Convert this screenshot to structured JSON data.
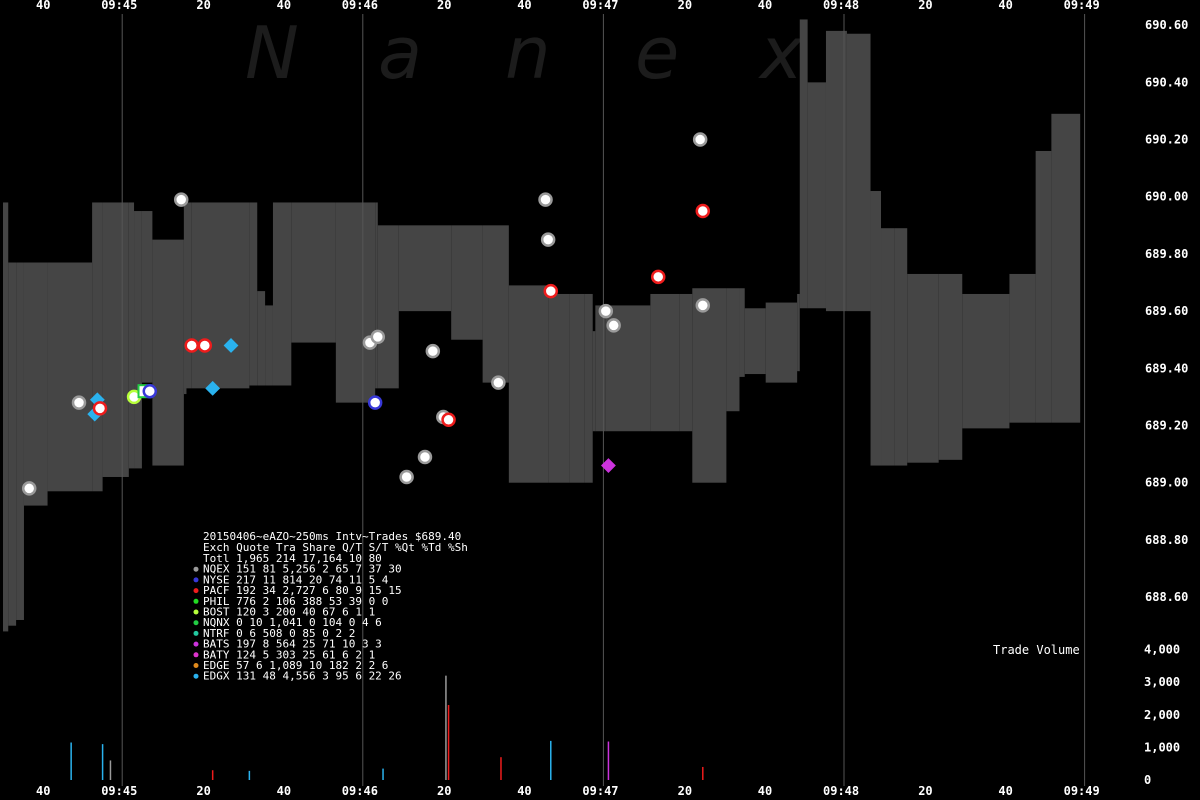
{
  "watermark": [
    "N",
    "a",
    "n",
    "e",
    "x"
  ],
  "chart_data": {
    "type": "scatter",
    "price_axis": {
      "ylim": [
        688.45,
        690.66
      ],
      "ticks": [
        "690.60",
        "690.40",
        "690.20",
        "690.00",
        "689.80",
        "689.60",
        "689.40",
        "689.20",
        "689.00",
        "688.80",
        "688.60"
      ]
    },
    "volume_axis": {
      "ylim": [
        0,
        4600
      ],
      "ticks": [
        "4,000",
        "3,000",
        "2,000",
        "1,000",
        "0"
      ],
      "label": "Trade Volume"
    },
    "time_axis": {
      "tick_labels": [
        "40",
        "09:45",
        "20",
        "40",
        "09:46",
        "20",
        "40",
        "09:47",
        "20",
        "40",
        "09:48",
        "20",
        "40",
        "09:49"
      ],
      "major_label_indices": [
        1,
        4,
        7,
        10,
        13
      ]
    },
    "nbbo_band": [
      [
        0,
        688.48,
        689.98
      ],
      [
        2,
        688.5,
        689.77
      ],
      [
        5,
        688.52,
        689.77
      ],
      [
        8,
        688.92,
        689.77
      ],
      [
        17,
        688.97,
        689.77
      ],
      [
        34,
        688.97,
        689.98
      ],
      [
        38,
        689.02,
        689.98
      ],
      [
        48,
        689.05,
        689.98
      ],
      [
        50,
        689.05,
        689.95
      ],
      [
        53,
        689.35,
        689.95
      ],
      [
        57,
        689.06,
        689.85
      ],
      [
        69,
        689.31,
        689.85
      ],
      [
        70,
        689.31,
        689.98
      ],
      [
        69,
        689.33,
        689.98
      ],
      [
        72,
        689.33,
        689.98
      ],
      [
        94,
        689.34,
        689.98
      ],
      [
        97,
        689.34,
        689.67
      ],
      [
        100,
        689.34,
        689.62
      ],
      [
        103,
        689.34,
        689.98
      ],
      [
        110,
        689.49,
        689.98
      ],
      [
        127,
        689.28,
        689.98
      ],
      [
        142,
        689.33,
        689.98
      ],
      [
        143,
        689.33,
        689.9
      ],
      [
        151,
        689.6,
        689.9
      ],
      [
        153,
        689.6,
        689.9
      ],
      [
        171,
        689.5,
        689.9
      ],
      [
        183,
        689.35,
        689.9
      ],
      [
        193,
        689.0,
        689.69
      ],
      [
        208,
        689.0,
        689.66
      ],
      [
        216,
        689.0,
        689.66
      ],
      [
        222,
        689.0,
        689.66
      ],
      [
        225,
        689.18,
        689.53
      ],
      [
        226,
        689.18,
        689.62
      ],
      [
        230,
        689.18,
        689.62
      ],
      [
        247,
        689.18,
        689.66
      ],
      [
        258,
        689.18,
        689.66
      ],
      [
        263,
        689.0,
        689.68
      ],
      [
        276,
        689.25,
        689.68
      ],
      [
        281,
        689.37,
        689.68
      ],
      [
        283,
        689.38,
        689.61
      ],
      [
        291,
        689.35,
        689.63
      ],
      [
        303,
        689.39,
        689.66
      ],
      [
        304,
        689.61,
        690.62
      ],
      [
        307,
        689.61,
        690.4
      ],
      [
        314,
        689.6,
        690.58
      ],
      [
        322,
        689.6,
        690.57
      ],
      [
        331,
        689.06,
        690.02
      ],
      [
        335,
        689.06,
        689.89
      ],
      [
        340,
        689.06,
        689.89
      ],
      [
        345,
        689.07,
        689.73
      ],
      [
        357,
        689.08,
        689.73
      ],
      [
        366,
        689.19,
        689.66
      ],
      [
        384,
        689.21,
        689.73
      ],
      [
        394,
        689.21,
        690.16
      ],
      [
        400,
        689.21,
        690.29
      ],
      [
        411,
        689.21,
        690.14
      ]
    ],
    "trades": [
      {
        "t": 10,
        "p": 688.98,
        "ex": "NQEX"
      },
      {
        "t": 29,
        "p": 689.28,
        "ex": "NQEX"
      },
      {
        "t": 35,
        "p": 689.24,
        "ex": "EDGX"
      },
      {
        "t": 36,
        "p": 689.29,
        "ex": "EDGX"
      },
      {
        "t": 37,
        "p": 689.26,
        "ex": "PACF"
      },
      {
        "t": 50,
        "p": 689.3,
        "ex": "BOST"
      },
      {
        "t": 54,
        "p": 689.32,
        "ex": "NQNX"
      },
      {
        "t": 56,
        "p": 689.32,
        "ex": "NYSE"
      },
      {
        "t": 68,
        "p": 689.99,
        "ex": "NQEX"
      },
      {
        "t": 72,
        "p": 689.48,
        "ex": "PACF"
      },
      {
        "t": 77,
        "p": 689.48,
        "ex": "PACF"
      },
      {
        "t": 80,
        "p": 689.33,
        "ex": "EDGX"
      },
      {
        "t": 87,
        "p": 689.48,
        "ex": "EDGX"
      },
      {
        "t": 140,
        "p": 689.49,
        "ex": "NQEX"
      },
      {
        "t": 142,
        "p": 689.28,
        "ex": "NYSE"
      },
      {
        "t": 143,
        "p": 689.51,
        "ex": "NQEX"
      },
      {
        "t": 154,
        "p": 689.02,
        "ex": "NQEX"
      },
      {
        "t": 161,
        "p": 689.09,
        "ex": "NQEX"
      },
      {
        "t": 164,
        "p": 689.46,
        "ex": "NQEX"
      },
      {
        "t": 168,
        "p": 689.23,
        "ex": "NQEX"
      },
      {
        "t": 170,
        "p": 689.22,
        "ex": "PACF"
      },
      {
        "t": 189,
        "p": 689.35,
        "ex": "NQEX"
      },
      {
        "t": 207,
        "p": 689.99,
        "ex": "NQEX"
      },
      {
        "t": 208,
        "p": 689.85,
        "ex": "NQEX"
      },
      {
        "t": 209,
        "p": 689.67,
        "ex": "PACF"
      },
      {
        "t": 230,
        "p": 689.6,
        "ex": "NQEX"
      },
      {
        "t": 231,
        "p": 689.06,
        "ex": "BATS"
      },
      {
        "t": 233,
        "p": 689.55,
        "ex": "NQEX"
      },
      {
        "t": 250,
        "p": 689.72,
        "ex": "PACF"
      },
      {
        "t": 266,
        "p": 690.2,
        "ex": "NQEX"
      },
      {
        "t": 267,
        "p": 689.62,
        "ex": "NQEX"
      },
      {
        "t": 267,
        "p": 689.95,
        "ex": "PACF"
      }
    ],
    "volume_bars": [
      {
        "t": 26,
        "v": 1150,
        "ex": "EDGX"
      },
      {
        "t": 38,
        "v": 1100,
        "ex": "EDGX"
      },
      {
        "t": 41,
        "v": 600,
        "ex": "NQEX"
      },
      {
        "t": 80,
        "v": 300,
        "ex": "PACF"
      },
      {
        "t": 94,
        "v": 280,
        "ex": "EDGX"
      },
      {
        "t": 145,
        "v": 350,
        "ex": "EDGX"
      },
      {
        "t": 169,
        "v": 3200,
        "ex": "NQEX"
      },
      {
        "t": 170,
        "v": 2300,
        "ex": "PACF"
      },
      {
        "t": 190,
        "v": 700,
        "ex": "PACF"
      },
      {
        "t": 209,
        "v": 1200,
        "ex": "EDGX"
      },
      {
        "t": 231,
        "v": 1180,
        "ex": "BATS"
      },
      {
        "t": 267,
        "v": 400,
        "ex": "PACF"
      }
    ],
    "exchange_colors": {
      "NQEX": "#9a9a9a",
      "NYSE": "#3838d8",
      "PACF": "#ee1c1c",
      "PHIL": "#22dd22",
      "BOST": "#b7ff3b",
      "NQNX": "#22cc44",
      "NTRF": "#22c9a0",
      "BATS": "#cc33dd",
      "BATY": "#dd33cc",
      "EDGE": "#e08a1c",
      "EDGX": "#2ab2ee"
    }
  },
  "stats": {
    "title": "20150406~eAZO~250ms Intv~Trades $689.40",
    "header": "Exch Quote Tra  Share  Q/T   S/T  %Qt %Td %Sh",
    "rows": [
      {
        "label": "Totl 1,965 214 17,164   10    80",
        "color": ""
      },
      {
        "label": "NQEX   151  81  5,256    2    65   7  37  30",
        "color": "#9a9a9a"
      },
      {
        "label": "NYSE   217  11    814   20    74  11   5   4",
        "color": "#3838d8"
      },
      {
        "label": "PACF   192  34  2,727    6    80   9  15  15",
        "color": "#ee1c1c"
      },
      {
        "label": "PHIL   776   2    106  388    53  39   0   0",
        "color": "#22dd22"
      },
      {
        "label": "BOST   120   3    200   40    67   6   1   1",
        "color": "#b7ff3b"
      },
      {
        "label": "NQNX     0  10  1,041    0   104   0   4   6",
        "color": "#22cc44"
      },
      {
        "label": "NTRF     0   6    508    0    85   0   2   2",
        "color": "#22c9a0"
      },
      {
        "label": "BATS   197   8    564   25    71  10   3   3",
        "color": "#cc33dd"
      },
      {
        "label": "BATY   124   5    303   25    61   6   2   1",
        "color": "#dd33cc"
      },
      {
        "label": "EDGE    57   6  1,089   10   182   2   2   6",
        "color": "#e08a1c"
      },
      {
        "label": "EDGX   131  48  4,556    3    95   6  22  26",
        "color": "#2ab2ee"
      }
    ]
  }
}
